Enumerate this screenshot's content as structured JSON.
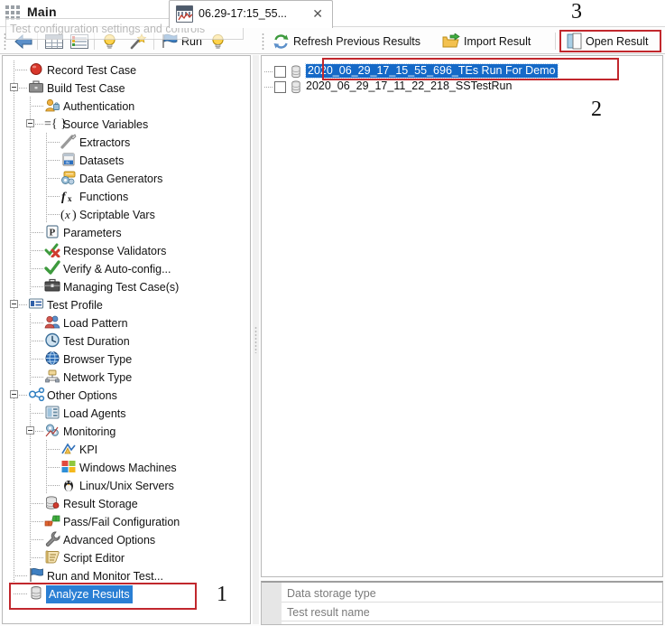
{
  "header": {
    "app_menu_icon": "grid-icon",
    "title": "Main"
  },
  "document_tab": {
    "icon": "chart-table-icon",
    "label": "06.29-17:15_55...",
    "close_label": "✕"
  },
  "tooltip": {
    "text": "Test configuration settings and controls"
  },
  "left_toolbar": {
    "items": [
      {
        "icon": "back-arrow-icon",
        "label": ""
      },
      {
        "icon": "table-grid-icon",
        "label": ""
      },
      {
        "icon": "list-view-icon",
        "label": ""
      },
      {
        "icon": "lightbulb-icon",
        "label": ""
      },
      {
        "icon": "magic-wand-icon",
        "label": ""
      },
      {
        "icon": "blue-flag-icon",
        "label": "Run"
      },
      {
        "icon": "lightbulb-icon",
        "label": ""
      }
    ]
  },
  "right_toolbar": {
    "refresh_label": "Refresh Previous Results",
    "refresh_icon": "refresh-icon",
    "import_label": "Import Result",
    "import_icon": "import-folder-icon",
    "open_label": "Open Result",
    "open_icon": "open-document-icon"
  },
  "tree": {
    "items": [
      {
        "label": "Record Test Case",
        "depth": 1,
        "icon": "red-record-icon",
        "expander": "none",
        "selected": false
      },
      {
        "label": "Build Test Case",
        "depth": 1,
        "icon": "briefcase-icon",
        "expander": "minus",
        "selected": false
      },
      {
        "label": "Authentication",
        "depth": 2,
        "icon": "user-lock-icon",
        "expander": "none",
        "selected": false
      },
      {
        "label": "Source Variables",
        "depth": 2,
        "icon": "braces-icon",
        "expander": "minus",
        "selected": false
      },
      {
        "label": "Extractors",
        "depth": 3,
        "icon": "extractor-icon",
        "expander": "none",
        "selected": false
      },
      {
        "label": "Datasets",
        "depth": 3,
        "icon": "dataset-icon",
        "expander": "none",
        "selected": false
      },
      {
        "label": "Data Generators",
        "depth": 3,
        "icon": "data-generator-icon",
        "expander": "none",
        "selected": false
      },
      {
        "label": "Functions",
        "depth": 3,
        "icon": "function-fx-icon",
        "expander": "none",
        "selected": false
      },
      {
        "label": "Scriptable Vars",
        "depth": 3,
        "icon": "scriptable-var-icon",
        "expander": "none",
        "selected": false
      },
      {
        "label": "Parameters",
        "depth": 2,
        "icon": "parameter-p-icon",
        "expander": "none",
        "selected": false
      },
      {
        "label": "Response Validators",
        "depth": 2,
        "icon": "check-cross-icon",
        "expander": "none",
        "selected": false
      },
      {
        "label": "Verify & Auto-config...",
        "depth": 2,
        "icon": "green-check-icon",
        "expander": "none",
        "selected": false
      },
      {
        "label": "Managing Test Case(s)",
        "depth": 2,
        "icon": "toolbox-icon",
        "expander": "none",
        "selected": false
      },
      {
        "label": "Test Profile",
        "depth": 1,
        "icon": "profile-card-icon",
        "expander": "minus",
        "selected": false
      },
      {
        "label": "Load Pattern",
        "depth": 2,
        "icon": "users-group-icon",
        "expander": "none",
        "selected": false
      },
      {
        "label": "Test Duration",
        "depth": 2,
        "icon": "clock-icon",
        "expander": "none",
        "selected": false
      },
      {
        "label": "Browser Type",
        "depth": 2,
        "icon": "globe-icon",
        "expander": "none",
        "selected": false
      },
      {
        "label": "Network Type",
        "depth": 2,
        "icon": "network-icon",
        "expander": "none",
        "selected": false
      },
      {
        "label": "Other Options",
        "depth": 1,
        "icon": "options-nodes-icon",
        "expander": "minus",
        "selected": false
      },
      {
        "label": "Load Agents",
        "depth": 2,
        "icon": "server-rack-icon",
        "expander": "none",
        "selected": false
      },
      {
        "label": "Monitoring",
        "depth": 2,
        "icon": "gears-monitor-icon",
        "expander": "minus",
        "selected": false
      },
      {
        "label": "KPI",
        "depth": 3,
        "icon": "kpi-chart-icon",
        "expander": "none",
        "selected": false
      },
      {
        "label": "Windows Machines",
        "depth": 3,
        "icon": "windows-logo-icon",
        "expander": "none",
        "selected": false
      },
      {
        "label": "Linux/Unix Servers",
        "depth": 3,
        "icon": "linux-penguin-icon",
        "expander": "none",
        "selected": false
      },
      {
        "label": "Result Storage",
        "depth": 2,
        "icon": "database-storage-icon",
        "expander": "none",
        "selected": false
      },
      {
        "label": "Pass/Fail Configuration",
        "depth": 2,
        "icon": "thumbs-updown-icon",
        "expander": "none",
        "selected": false
      },
      {
        "label": "Advanced Options",
        "depth": 2,
        "icon": "wrench-icon",
        "expander": "none",
        "selected": false
      },
      {
        "label": "Script Editor",
        "depth": 2,
        "icon": "script-editor-icon",
        "expander": "none",
        "selected": false
      },
      {
        "label": "Run and Monitor Test...",
        "depth": 1,
        "icon": "blue-flag-icon",
        "expander": "none",
        "selected": false
      },
      {
        "label": "Analyze Results",
        "depth": 1,
        "icon": "database-analyze-icon",
        "expander": "none",
        "selected": true
      }
    ]
  },
  "results": {
    "rows": [
      {
        "name": "2020_06_29_17_15_55_696_TEs Run For Demo",
        "checked": false,
        "selected": true,
        "icon": "database-icon"
      },
      {
        "name": "2020_06_29_17_11_22_218_SSTestRun",
        "checked": false,
        "selected": false,
        "icon": "database-icon"
      }
    ]
  },
  "property_grid": {
    "rows": [
      {
        "label": "Data storage type"
      },
      {
        "label": "Test result name"
      }
    ]
  },
  "annotations": [
    {
      "number": "1",
      "target": "analyze-results-tree-item"
    },
    {
      "number": "2",
      "target": "selected-result-row"
    },
    {
      "number": "3",
      "target": "open-result-button"
    }
  ],
  "colors": {
    "annotation_red": "#c1272d",
    "selection_blue": "#1569c7",
    "tree_selection_blue": "#2a7fd4",
    "panel_border": "#b9b9b9"
  }
}
